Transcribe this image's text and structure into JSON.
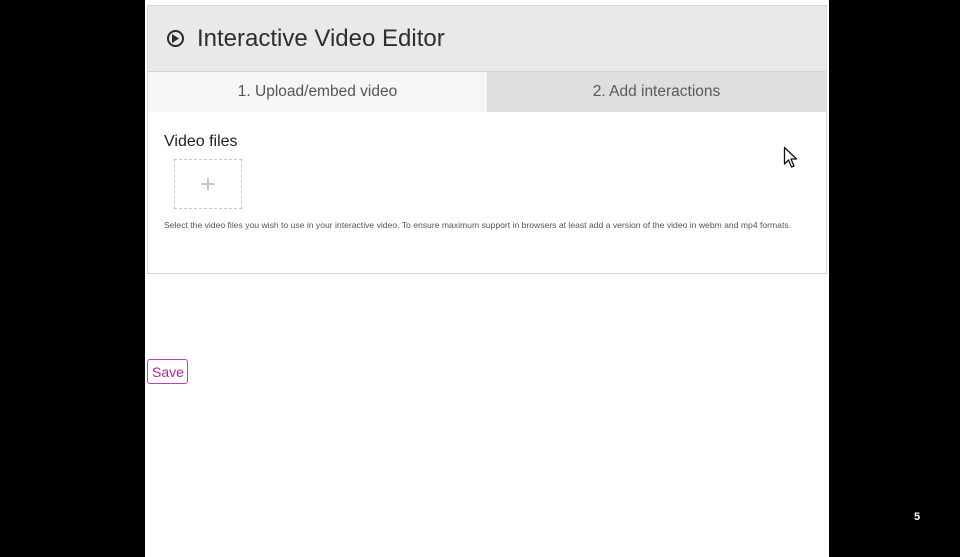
{
  "editor": {
    "title": "Interactive Video Editor",
    "icon": "play-circle-icon",
    "tabs": [
      {
        "label": "1. Upload/embed video",
        "active": true
      },
      {
        "label": "2. Add interactions",
        "active": false
      }
    ]
  },
  "upload": {
    "label": "Video files",
    "add_symbol": "+",
    "description": "Select the video files you wish to use in your interactive video. To ensure maximum support in browsers at least add a version of the video in webm and mp4 formats."
  },
  "actions": {
    "save_label": "Save"
  },
  "slide": {
    "number": "5"
  },
  "colors": {
    "accent": "#b8249f",
    "header_bg": "#e9e9e9",
    "tab_inactive_bg": "#dedede"
  }
}
